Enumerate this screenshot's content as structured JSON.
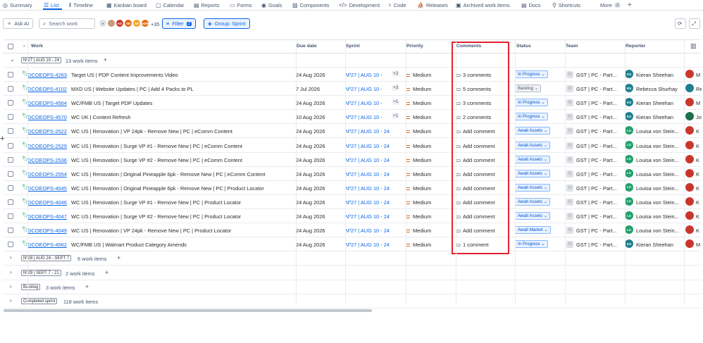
{
  "tabs": [
    {
      "label": "Summary",
      "icon": "globe-icon"
    },
    {
      "label": "List",
      "icon": "list-icon",
      "active": true
    },
    {
      "label": "Timeline",
      "icon": "timeline-icon"
    },
    {
      "label": "Kanban board",
      "icon": "board-icon"
    },
    {
      "label": "Calendar",
      "icon": "calendar-icon"
    },
    {
      "label": "Reports",
      "icon": "reports-icon"
    },
    {
      "label": "Forms",
      "icon": "forms-icon"
    },
    {
      "label": "Goals",
      "icon": "goals-icon"
    },
    {
      "label": "Components",
      "icon": "components-icon"
    },
    {
      "label": "Development",
      "icon": "code-icon"
    },
    {
      "label": "Code",
      "icon": "branch-icon"
    },
    {
      "label": "Releases",
      "icon": "ship-icon"
    },
    {
      "label": "Archived work items",
      "icon": "archive-icon"
    },
    {
      "label": "Docs",
      "icon": "doc-icon"
    },
    {
      "label": "Shortcuts",
      "icon": "link-icon"
    },
    {
      "label": "More",
      "icon": "",
      "badge": "2"
    }
  ],
  "toolbar": {
    "ask_ai": "Ask AI",
    "search_placeholder": "Search work",
    "avatar_overflow": "+35",
    "avatars": [
      "AO",
      "AB",
      "AP",
      "ADM"
    ],
    "filter_label": "Filter",
    "filter_count": "2",
    "group_label": "Group: Sprint"
  },
  "columns": {
    "work": "Work",
    "due": "Due date",
    "sprint": "Sprint",
    "priority": "Priority",
    "comments": "Comments",
    "status": "Status",
    "team": "Team",
    "reporter": "Reporter"
  },
  "group_open": {
    "tag": "Nº27 | AUG 10 - 24",
    "count": "13 work items"
  },
  "rows": [
    {
      "key": "DCOEOPS-4263",
      "summary": "Target US | PDP Content Improvements Video",
      "due": "24 Aug 2026",
      "sprint": "Nº27 | AUG 10 -",
      "more": "+2",
      "priority": "Medium",
      "comments": "3 comments",
      "status": "In Progress",
      "st": "blue",
      "team": "GST | PC - Part...",
      "reporter": "Kieran Sheehan",
      "ri": "KS",
      "rc": "#1d7f8c",
      "ex": "M",
      "exc": "#c9372c"
    },
    {
      "key": "DCOEOPS-4102",
      "summary": "MXD US | Website Updates | PC | Add 4 Packs to PL",
      "due": "7 Jul 2026",
      "sprint": "Nº27 | AUG 10 -",
      "more": "+3",
      "priority": "Medium",
      "comments": "5 comments",
      "status": "Backlog",
      "st": "grey",
      "team": "GST | PC - Part...",
      "reporter": "Rebecca Shurhay",
      "ri": "RS",
      "rc": "#1d7f8c",
      "ex": "Re",
      "exc": "#1d7f8c"
    },
    {
      "key": "DCOEOPS-4564",
      "summary": "WC/FMB US | Target PDP Updates",
      "due": "24 Aug 2026",
      "sprint": "Nº27 | AUG 10 -",
      "more": "+1",
      "priority": "Medium",
      "comments": "3 comments",
      "status": "In Progress",
      "st": "blue",
      "team": "GST | PC - Part...",
      "reporter": "Kieran Sheehan",
      "ri": "KS",
      "rc": "#1d7f8c",
      "ex": "M",
      "exc": "#c9372c"
    },
    {
      "key": "DCOEOPS-4570",
      "summary": "WC UK | Content Refresh",
      "due": "10 Aug 2026",
      "sprint": "Nº27 | AUG 10 -",
      "more": "+1",
      "priority": "Medium",
      "comments": "2 comments",
      "status": "In Progress",
      "st": "blue",
      "team": "GST | PC - Part...",
      "reporter": "Kieran Sheehan",
      "ri": "KS",
      "rc": "#1d7f8c",
      "ex": "Jo",
      "exc": "#216e4e"
    },
    {
      "key": "DCOEOPS-2522",
      "summary": "WC US | Renovation | VP 24pk - Remove New | PC | eComm Content",
      "due": "24 Aug 2026",
      "sprint": "Nº27 | AUG 10 - 24",
      "more": "",
      "priority": "Medium",
      "comments": "Add comment",
      "status": "Await Assets",
      "st": "blue",
      "team": "GST | PC - Part...",
      "reporter": "Louisa von Stein...",
      "ri": "LS",
      "rc": "#22a06b",
      "ex": "K",
      "exc": "#c9372c"
    },
    {
      "key": "DCOEOPS-2529",
      "summary": "WC US | Renovation | Surge VP #1 - Remove New | PC | eComm Content",
      "due": "24 Aug 2026",
      "sprint": "Nº27 | AUG 10 - 24",
      "more": "",
      "priority": "Medium",
      "comments": "Add comment",
      "status": "Await Assets",
      "st": "blue",
      "team": "GST | PC - Part...",
      "reporter": "Louisa von Stein...",
      "ri": "LS",
      "rc": "#22a06b",
      "ex": "K",
      "exc": "#c9372c"
    },
    {
      "key": "DCOEOPS-2536",
      "summary": "WC US | Renovation | Surge VP #2 - Remove New | PC | eComm Content",
      "due": "24 Aug 2026",
      "sprint": "Nº27 | AUG 10 - 24",
      "more": "",
      "priority": "Medium",
      "comments": "Add comment",
      "status": "Await Assets",
      "st": "blue",
      "team": "GST | PC - Part...",
      "reporter": "Louisa von Stein...",
      "ri": "LS",
      "rc": "#22a06b",
      "ex": "K",
      "exc": "#c9372c"
    },
    {
      "key": "DCOEOPS-2554",
      "summary": "WC US | Renovation | Original Pineapple 6pk - Remove New | PC | eComm Content",
      "due": "24 Aug 2026",
      "sprint": "Nº27 | AUG 10 - 24",
      "more": "",
      "priority": "Medium",
      "comments": "Add comment",
      "status": "Await Assets",
      "st": "blue",
      "team": "GST | PC - Part...",
      "reporter": "Louisa von Stein...",
      "ri": "LS",
      "rc": "#22a06b",
      "ex": "K",
      "exc": "#c9372c"
    },
    {
      "key": "DCOEOPS-4045",
      "summary": "WC US | Renovation | Original Pineapple 6pk - Remove New | PC | Product Locator",
      "due": "24 Aug 2026",
      "sprint": "Nº27 | AUG 10 - 24",
      "more": "",
      "priority": "Medium",
      "comments": "Add comment",
      "status": "Await Assets",
      "st": "blue",
      "team": "GST | PC - Part...",
      "reporter": "Louisa von Stein...",
      "ri": "LS",
      "rc": "#22a06b",
      "ex": "K",
      "exc": "#c9372c"
    },
    {
      "key": "DCOEOPS-4046",
      "summary": "WC US | Renovation | Surge VP #1 - Remove New | PC | Product Locator",
      "due": "24 Aug 2026",
      "sprint": "Nº27 | AUG 10 - 24",
      "more": "",
      "priority": "Medium",
      "comments": "Add comment",
      "status": "Await Assets",
      "st": "blue",
      "team": "GST | PC - Part...",
      "reporter": "Louisa von Stein...",
      "ri": "LS",
      "rc": "#22a06b",
      "ex": "K",
      "exc": "#c9372c"
    },
    {
      "key": "DCOEOPS-4047",
      "summary": "WC US | Renovation | Surge VP #2 - Remove New | PC | Product Locator",
      "due": "24 Aug 2026",
      "sprint": "Nº27 | AUG 10 - 24",
      "more": "",
      "priority": "Medium",
      "comments": "Add comment",
      "status": "Await Assets",
      "st": "blue",
      "team": "GST | PC - Part...",
      "reporter": "Louisa von Stein...",
      "ri": "LS",
      "rc": "#22a06b",
      "ex": "K",
      "exc": "#c9372c"
    },
    {
      "key": "DCOEOPS-4049",
      "summary": "WC US | Renovation | VP 24pk - Remove New | PC | Product Locator",
      "due": "24 Aug 2026",
      "sprint": "Nº27 | AUG 10 - 24",
      "more": "",
      "priority": "Medium",
      "comments": "Add comment",
      "status": "Await Market",
      "st": "blue",
      "team": "GST | PC - Part...",
      "reporter": "Louisa von Stein...",
      "ri": "LS",
      "rc": "#22a06b",
      "ex": "K",
      "exc": "#c9372c"
    },
    {
      "key": "DCOEOPS-4562",
      "summary": "WC/FMB US | Walmart Product Category Amends",
      "due": "24 Aug 2026",
      "sprint": "Nº27 | AUG 10 - 24",
      "more": "",
      "priority": "Medium",
      "comments": "1 comment",
      "status": "In Progress",
      "st": "blue",
      "team": "GST | PC - Part...",
      "reporter": "Kieran Sheehan",
      "ri": "KS",
      "rc": "#1d7f8c",
      "ex": "M",
      "exc": "#c9372c"
    }
  ],
  "groups": [
    {
      "tag": "Nº28 | AUG 24 - SEPT 7",
      "count": "6 work items"
    },
    {
      "tag": "Nº29 | SEPT 7 - 21",
      "count": "2 work items"
    },
    {
      "tag": "Backlog",
      "count": "3 work items"
    },
    {
      "tag": "Completed sprint",
      "count": "118 work items"
    }
  ],
  "colors": {
    "accent": "#0c66e4",
    "highlight": "#e2212f",
    "priority": "#e56910"
  }
}
